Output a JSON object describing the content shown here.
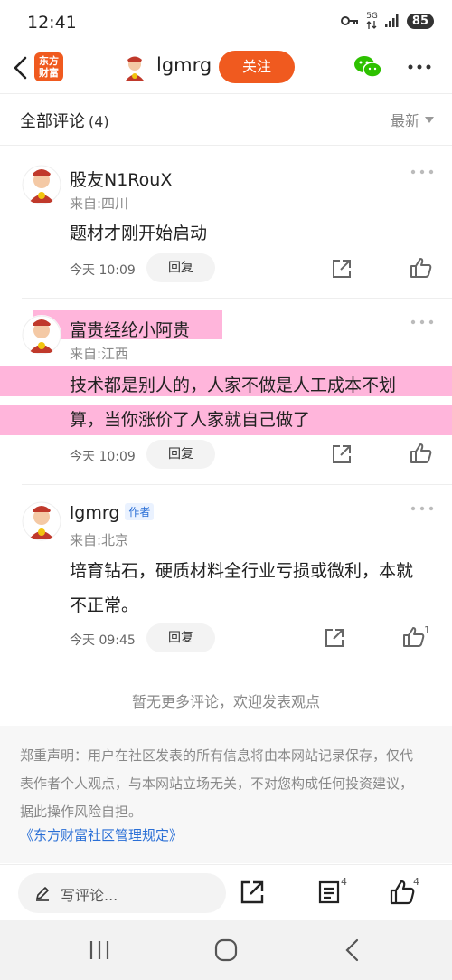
{
  "status_bar": {
    "time": "12:41",
    "network": "5G",
    "battery": "85"
  },
  "header": {
    "brand_line1": "东方",
    "brand_line2": "财富",
    "username": "lgmrg",
    "follow_label": "关注"
  },
  "comments_header": {
    "title": "全部评论",
    "count": "(4)",
    "sort_label": "最新"
  },
  "comments": [
    {
      "name": "股友N1RouX",
      "from": "来自:四川",
      "lines": [
        "题材才刚开始启动"
      ],
      "time": "今天 10:09",
      "reply_label": "回复",
      "likes": ""
    },
    {
      "name": "富贵经纶小阿贵",
      "from": "来自:江西",
      "lines": [
        "技术都是别人的，人家不做是人工成本不划",
        "算，当你涨价了人家就自己做了"
      ],
      "time": "今天 10:09",
      "reply_label": "回复",
      "likes": ""
    },
    {
      "name": "lgmrg",
      "author_tag": "作者",
      "from": "来自:北京",
      "lines": [
        "培育钻石，硬质材料全行业亏损或微利，本就",
        "不正常。"
      ],
      "time": "今天 09:45",
      "reply_label": "回复",
      "likes": "1"
    }
  ],
  "no_more_text": "暂无更多评论，欢迎发表观点",
  "disclaimer": {
    "lines": [
      "郑重声明：用户在社区发表的所有信息将由本网站记录保存，仅代",
      "表作者个人观点，与本网站立场无关，不对您构成任何投资建议，",
      "据此操作风险自担。"
    ],
    "rules_link": "《东方财富社区管理规定》"
  },
  "bottom_bar": {
    "input_placeholder": "写评论...",
    "comment_count": "4",
    "like_count": "4"
  },
  "colors": {
    "accent": "#f05a1f",
    "link": "#2a6fd6",
    "highlight": "#ff78be"
  },
  "icons": [
    "back-arrow-icon",
    "wechat-icon",
    "more-dots-icon",
    "share-icon",
    "thumbs-up-icon",
    "pen-icon",
    "list-icon",
    "recents-icon",
    "home-icon",
    "nav-back-icon"
  ]
}
